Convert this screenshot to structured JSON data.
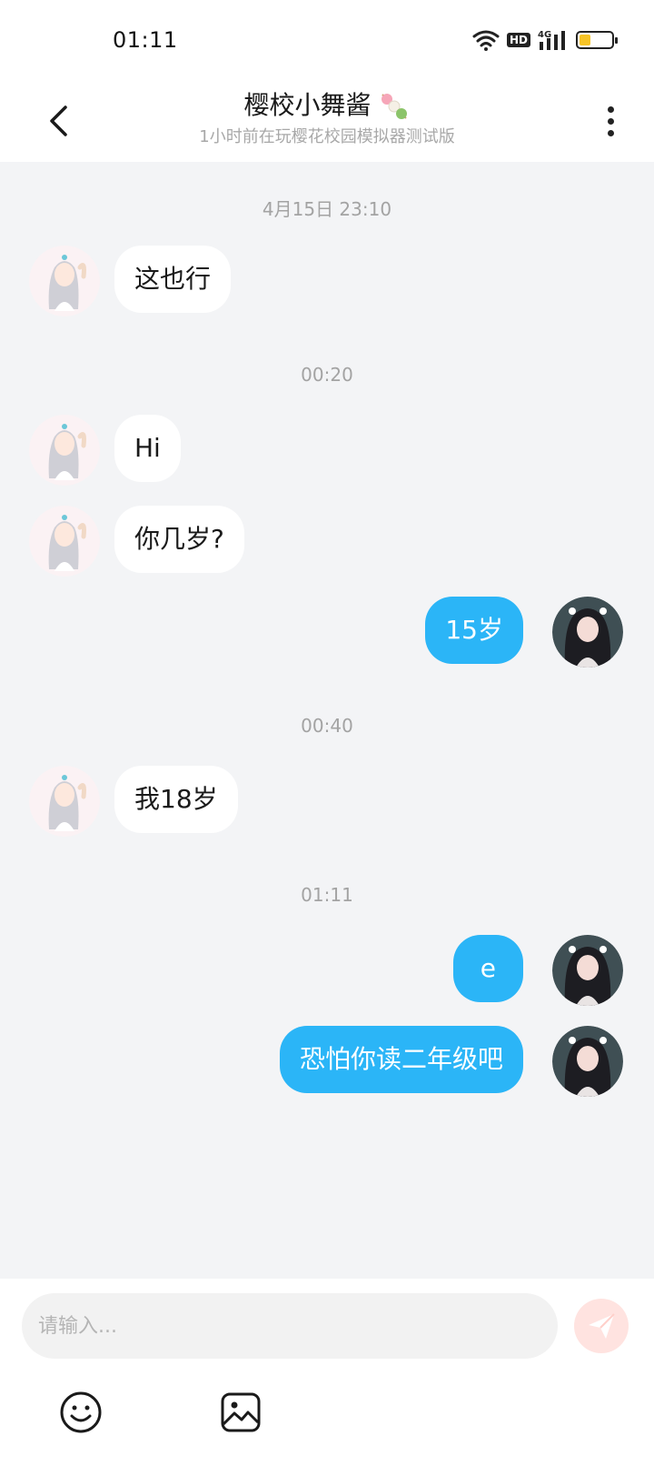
{
  "status_bar": {
    "time": "01:11",
    "hd_label": "HD",
    "network_label": "4G",
    "battery_level": 0.35
  },
  "header": {
    "title": "樱校小舞酱",
    "subtitle": "1小时前在玩樱花校园模拟器测试版"
  },
  "messages": {
    "ts1": "4月15日 23:10",
    "m1": "这也行",
    "ts2": "00:20",
    "m2": "Hi",
    "m3": "你几岁?",
    "m4": "15岁",
    "ts3": "00:40",
    "m5": "我18岁",
    "ts4": "01:11",
    "m6": "e",
    "m7": "恐怕你读二年级吧"
  },
  "composer": {
    "placeholder": "请输入..."
  },
  "icons": {
    "back": "chevron-left-icon",
    "more": "more-vertical-icon",
    "send": "send-icon",
    "emoji": "emoji-icon",
    "image": "image-icon"
  },
  "colors": {
    "outgoing_bubble": "#2bb5f7",
    "incoming_bubble": "#ffffff",
    "chat_background": "#f3f4f6",
    "send_button": "#ffe3e0",
    "battery": "#f6c326"
  }
}
